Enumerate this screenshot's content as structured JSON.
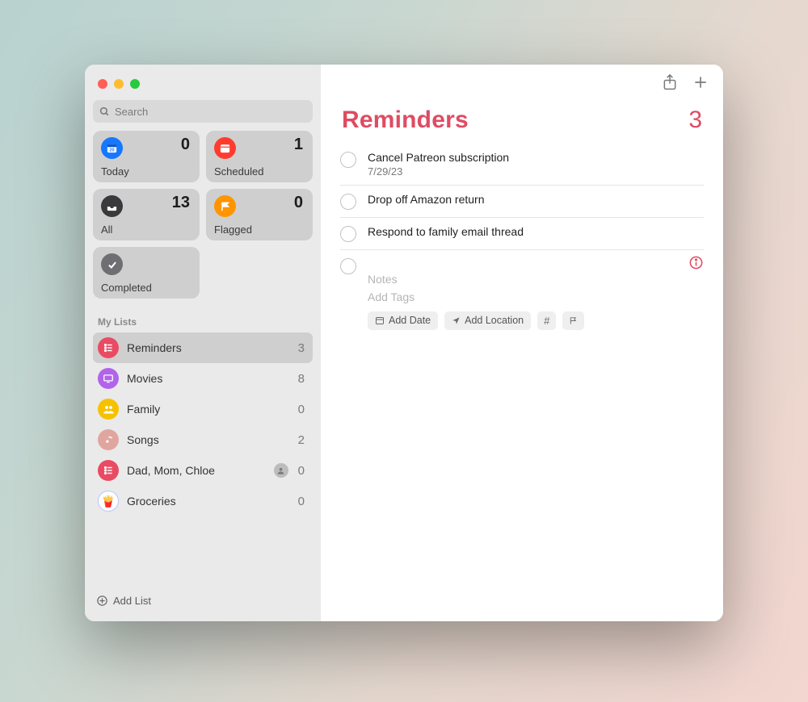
{
  "search": {
    "placeholder": "Search"
  },
  "smart": {
    "today": {
      "label": "Today",
      "count": "0"
    },
    "scheduled": {
      "label": "Scheduled",
      "count": "1"
    },
    "all": {
      "label": "All",
      "count": "13"
    },
    "flagged": {
      "label": "Flagged",
      "count": "0"
    },
    "completed": {
      "label": "Completed"
    }
  },
  "sidebar": {
    "section_label": "My Lists",
    "lists": [
      {
        "name": "Reminders",
        "count": "3",
        "color": "#e94b63"
      },
      {
        "name": "Movies",
        "count": "8",
        "color": "#b164e9"
      },
      {
        "name": "Family",
        "count": "0",
        "color": "#f6c200"
      },
      {
        "name": "Songs",
        "count": "2",
        "color": "#e1a5a0"
      },
      {
        "name": "Dad, Mom, Chloe",
        "count": "0",
        "color": "#e94b63",
        "shared": true
      },
      {
        "name": "Groceries",
        "count": "0",
        "color": "#ffffff",
        "emoji": true
      }
    ],
    "add_list_label": "Add List"
  },
  "main": {
    "title": "Reminders",
    "count": "3",
    "items": [
      {
        "title": "Cancel Patreon subscription",
        "subtitle": "7/29/23"
      },
      {
        "title": "Drop off Amazon return"
      },
      {
        "title": "Respond to family email thread"
      }
    ],
    "new_item": {
      "notes_placeholder": "Notes",
      "tags_placeholder": "Add Tags",
      "chips": {
        "date": "Add Date",
        "location": "Add Location"
      }
    }
  },
  "colors": {
    "accent": "#de4c63",
    "today": "#1677ff",
    "scheduled": "#ff3b30",
    "all": "#3a3a3c",
    "flagged": "#ff9500",
    "completed": "#6e6e73"
  }
}
